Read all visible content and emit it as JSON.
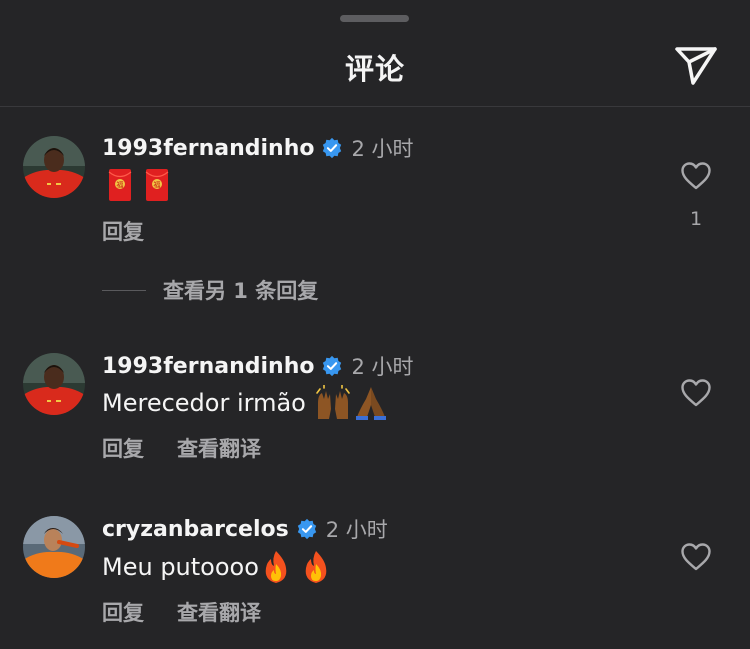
{
  "header": {
    "title": "评论",
    "share_icon": "send-icon"
  },
  "comments": [
    {
      "username": "1993fernandinho",
      "verified": true,
      "time": "2 小时",
      "text": "",
      "emojis": [
        "red-envelope",
        "red-envelope"
      ],
      "actions": {
        "reply": "回复"
      },
      "likes": "1",
      "view_replies": "查看另 1 条回复"
    },
    {
      "username": "1993fernandinho",
      "verified": true,
      "time": "2 小时",
      "text": "Merecedor irmão",
      "emojis": [
        "raising-hands",
        "folded-hands"
      ],
      "actions": {
        "reply": "回复",
        "translate": "查看翻译"
      }
    },
    {
      "username": "cryzanbarcelos",
      "verified": true,
      "time": "2 小时",
      "text": "Meu putoooo",
      "emojis": [
        "fire",
        "fire"
      ],
      "actions": {
        "reply": "回复",
        "translate": "查看翻译"
      }
    }
  ],
  "colors": {
    "background": "#252527",
    "secondary_text": "#a8a8ab",
    "verified_blue": "#3897f0"
  }
}
